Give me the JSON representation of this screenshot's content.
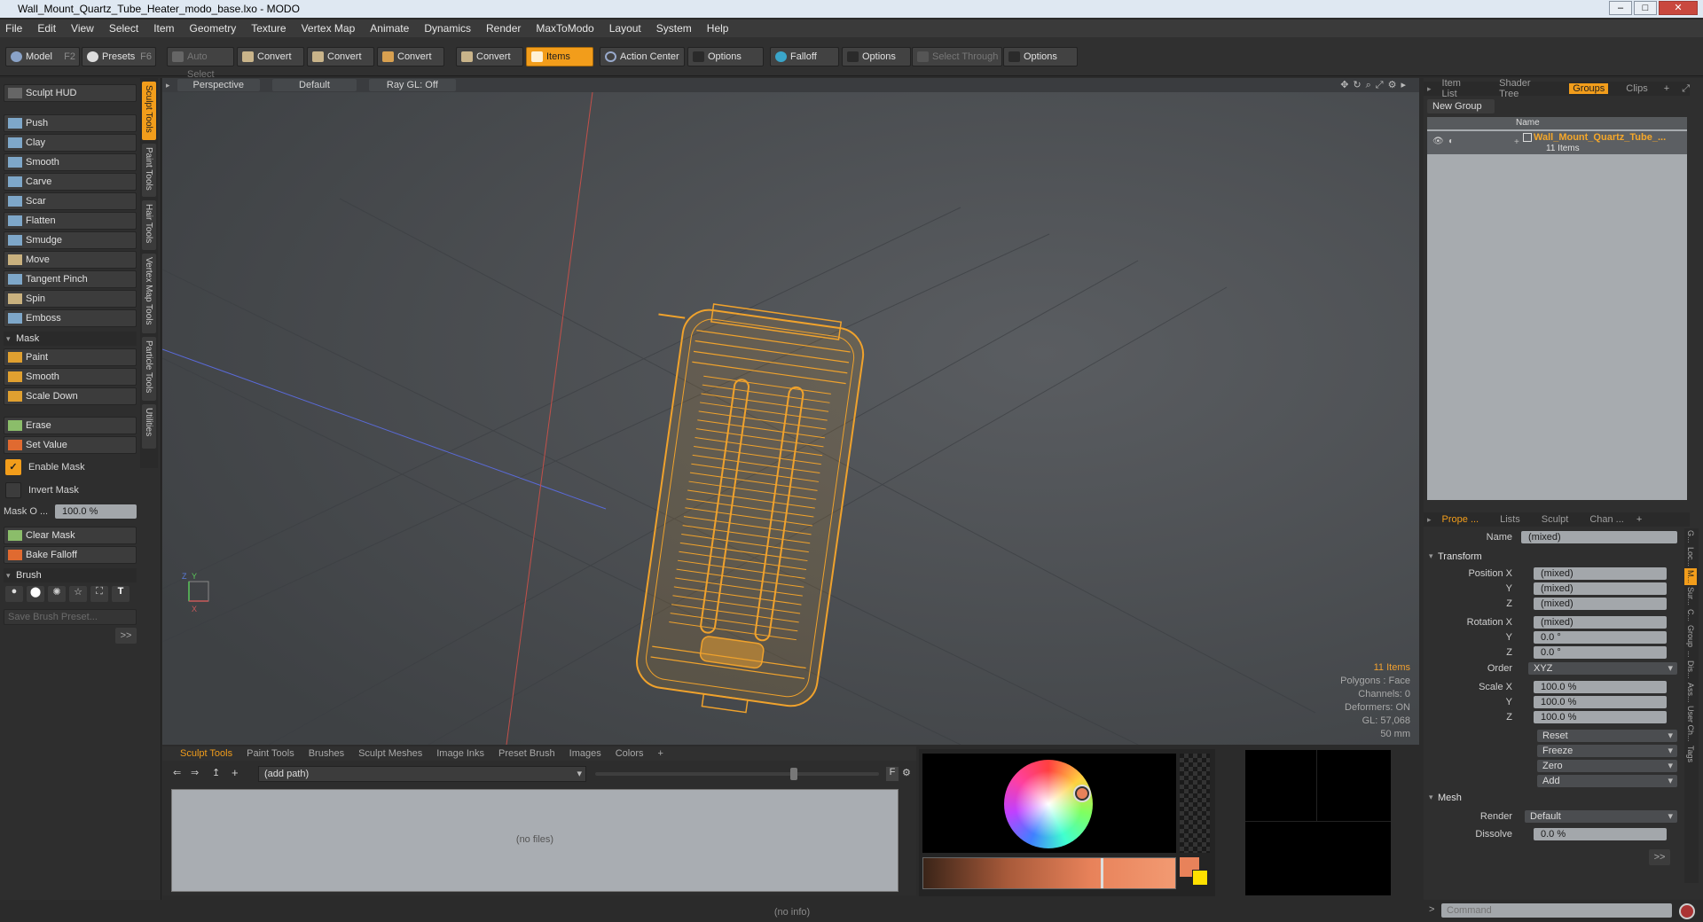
{
  "window": {
    "title": "Wall_Mount_Quartz_Tube_Heater_modo_base.lxo - MODO"
  },
  "menu": [
    "File",
    "Edit",
    "View",
    "Select",
    "Item",
    "Geometry",
    "Texture",
    "Vertex Map",
    "Animate",
    "Dynamics",
    "Render",
    "MaxToModo",
    "Layout",
    "System",
    "Help"
  ],
  "toolbar": {
    "model": "Model",
    "model_key": "F2",
    "presets": "Presets",
    "presets_key": "F6",
    "auto_select": "Auto Select",
    "convert1": "Convert",
    "convert2": "Convert",
    "convert3": "Convert",
    "convert4": "Convert",
    "items": "Items",
    "action_center": "Action Center",
    "options1": "Options",
    "falloff": "Falloff",
    "options2": "Options",
    "select_through": "Select Through",
    "options3": "Options"
  },
  "left": {
    "sculpt_hud": "Sculpt HUD",
    "tools": [
      "Push",
      "Clay",
      "Smooth",
      "Carve",
      "Scar",
      "Flatten",
      "Smudge",
      "Move",
      "Tangent Pinch",
      "Spin",
      "Emboss"
    ],
    "mask_section": "Mask",
    "mask_tools": [
      "Paint",
      "Smooth",
      "Scale Down"
    ],
    "erase": "Erase",
    "set_value": "Set Value",
    "enable_mask": "Enable Mask",
    "invert_mask": "Invert Mask",
    "mask_opacity_label": "Mask O ...",
    "mask_opacity_value": "100.0 %",
    "clear_mask": "Clear Mask",
    "bake_falloff": "Bake Falloff",
    "brush_section": "Brush",
    "save_brush_preset": "Save Brush Preset...",
    "expand": ">>",
    "vtabs": [
      "Sculpt Tools",
      "Paint Tools",
      "Hair Tools",
      "Vertex Map Tools",
      "Particle Tools",
      "Utilities"
    ]
  },
  "viewport": {
    "tabs": [
      "Perspective",
      "Default",
      "Ray GL: Off"
    ],
    "info": {
      "items": "11 Items",
      "polygons": "Polygons : Face",
      "channels": "Channels: 0",
      "deformers": "Deformers: ON",
      "gl": "GL: 57,068",
      "scale": "50 mm"
    },
    "axis_x": "X",
    "axis_y": "Y",
    "axis_z": "Z"
  },
  "bottom": {
    "tabs": [
      "Sculpt Tools",
      "Paint Tools",
      "Brushes",
      "Sculpt Meshes",
      "Image Inks",
      "Preset Brush",
      "Images",
      "Colors"
    ],
    "add_tab": "+",
    "path": "(add path)",
    "no_files": "(no files)",
    "f_label": "F"
  },
  "right": {
    "top_tabs": [
      "Item List",
      "Shader Tree",
      "Groups",
      "Clips"
    ],
    "new_group": "New Group",
    "col_name": "Name",
    "group_name": "Wall_Mount_Quartz_Tube_...",
    "group_count": "11 Items",
    "prop_tabs": [
      "Prope ...",
      "Lists",
      "Sculpt",
      "Chan ..."
    ],
    "name_label": "Name",
    "name_value": "(mixed)",
    "transform": "Transform",
    "position_x_label": "Position X",
    "position_x": "(mixed)",
    "position_y": "(mixed)",
    "position_z": "(mixed)",
    "rotation_x_label": "Rotation X",
    "rotation_x": "(mixed)",
    "rotation_y": "0.0 °",
    "rotation_z": "0.0 °",
    "order_label": "Order",
    "order": "XYZ",
    "scale_x_label": "Scale X",
    "scale_x": "100.0 %",
    "scale_y": "100.0 %",
    "scale_z": "100.0 %",
    "y_label": "Y",
    "z_label": "Z",
    "actions": [
      "Reset",
      "Freeze",
      "Zero",
      "Add"
    ],
    "mesh": "Mesh",
    "render_label": "Render",
    "render": "Default",
    "dissolve_label": "Dissolve",
    "dissolve": "0.0 %",
    "expand": ">>",
    "side_tabs": [
      "G...",
      "Loc...",
      "M...",
      "Sur...",
      "C...",
      "Group",
      "...",
      "Dis...",
      "Ass...",
      "User Ch...",
      "Tags"
    ]
  },
  "status": {
    "info": "(no info)",
    "command_placeholder": "Command"
  },
  "colors": {
    "accent": "#f29d1b",
    "wire": "#f0a22c",
    "swatch": "#e8825a"
  }
}
